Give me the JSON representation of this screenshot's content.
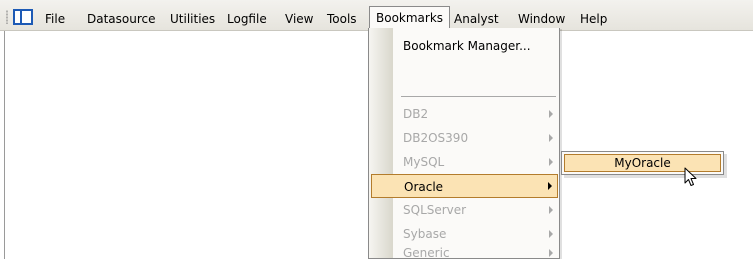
{
  "menubar": {
    "items": [
      {
        "label": "File"
      },
      {
        "label": "Datasource"
      },
      {
        "label": "Utilities"
      },
      {
        "label": "Logfile"
      },
      {
        "label": "View"
      },
      {
        "label": "Tools"
      },
      {
        "label": "Bookmarks"
      },
      {
        "label": "Analyst"
      },
      {
        "label": "Window"
      },
      {
        "label": "Help"
      }
    ]
  },
  "bookmarks_menu": {
    "manager_label": "Bookmark Manager...",
    "items": [
      {
        "label": "DB2"
      },
      {
        "label": "DB2OS390"
      },
      {
        "label": "MySQL"
      },
      {
        "label": "Oracle"
      },
      {
        "label": "SQLServer"
      },
      {
        "label": "Sybase"
      },
      {
        "label": "Generic"
      }
    ]
  },
  "oracle_submenu": {
    "items": [
      {
        "label": "MyOracle"
      }
    ]
  },
  "colors": {
    "highlight_fill": "#fbe3b4",
    "highlight_border": "#b37c2c",
    "disabled_text": "#a8a8a8"
  }
}
